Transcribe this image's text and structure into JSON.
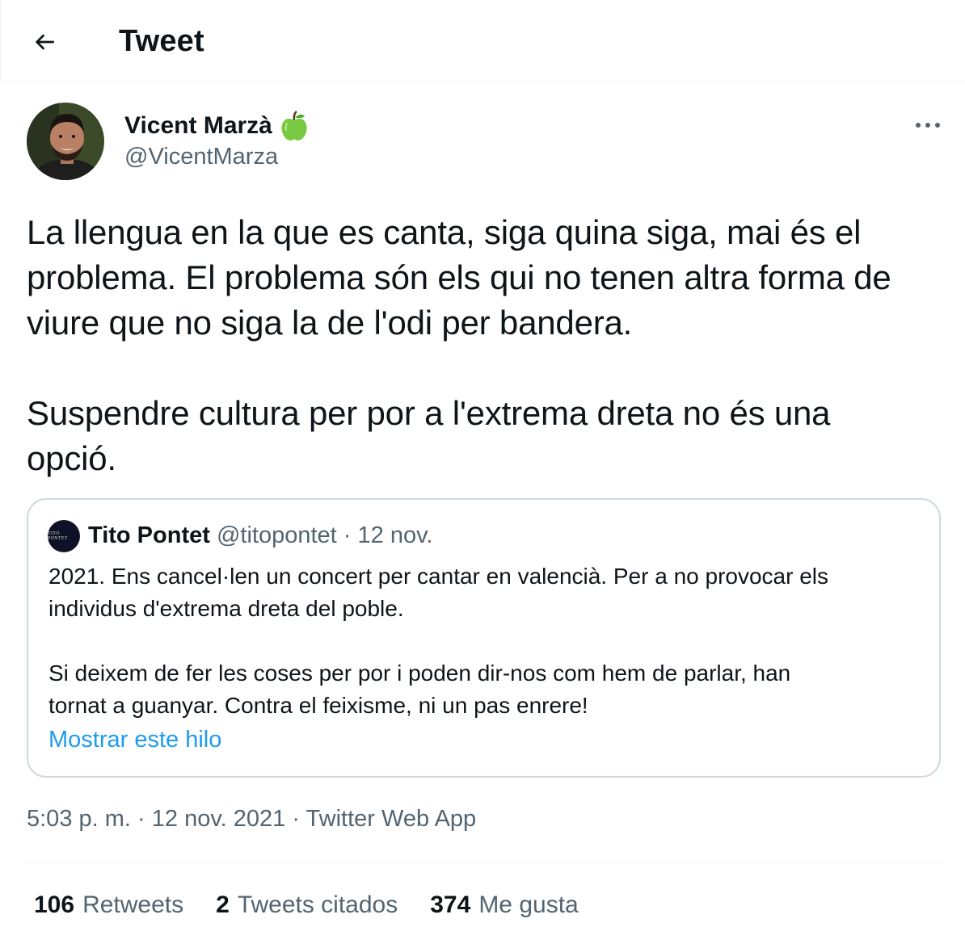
{
  "header": {
    "title": "Tweet"
  },
  "author": {
    "name": "Vicent Marzà",
    "handle": "@VicentMarza"
  },
  "tweet": {
    "text": "La llengua en la que es canta, siga quina siga, mai és el\nproblema. El problema són els qui no tenen altra forma de\nviure que no siga la de l'odi per bandera.\n\nSuspendre cultura per por a l'extrema dreta no és una\nopció."
  },
  "quote": {
    "avatar_text": "TITO PONTET",
    "name": "Tito Pontet",
    "handle": "@titopontet",
    "separator": " · ",
    "date": "12 nov.",
    "text": "2021. Ens cancel·len un concert per cantar en valencià. Per a no provocar els\nindividus d'extrema dreta del poble.\n\nSi deixem de fer les coses per por i poden dir-nos com hem de parlar, han\ntornat a guanyar. Contra el feixisme, ni un pas enrere!",
    "show_thread": "Mostrar este hilo"
  },
  "meta": {
    "time": "5:03 p. m.",
    "separator": " · ",
    "date": "12 nov. 2021",
    "source": "Twitter Web App"
  },
  "stats": {
    "retweets_count": "106",
    "retweets_label": "Retweets",
    "quotes_count": "2",
    "quotes_label": "Tweets citados",
    "likes_count": "374",
    "likes_label": "Me gusta"
  },
  "colors": {
    "text": "#0f1419",
    "secondary": "#536471",
    "link": "#1d9bf0",
    "border": "#cfd9de"
  },
  "icons": {
    "back": "arrow-left-icon",
    "badge": "green-apple-icon",
    "more": "more-dots-icon"
  }
}
